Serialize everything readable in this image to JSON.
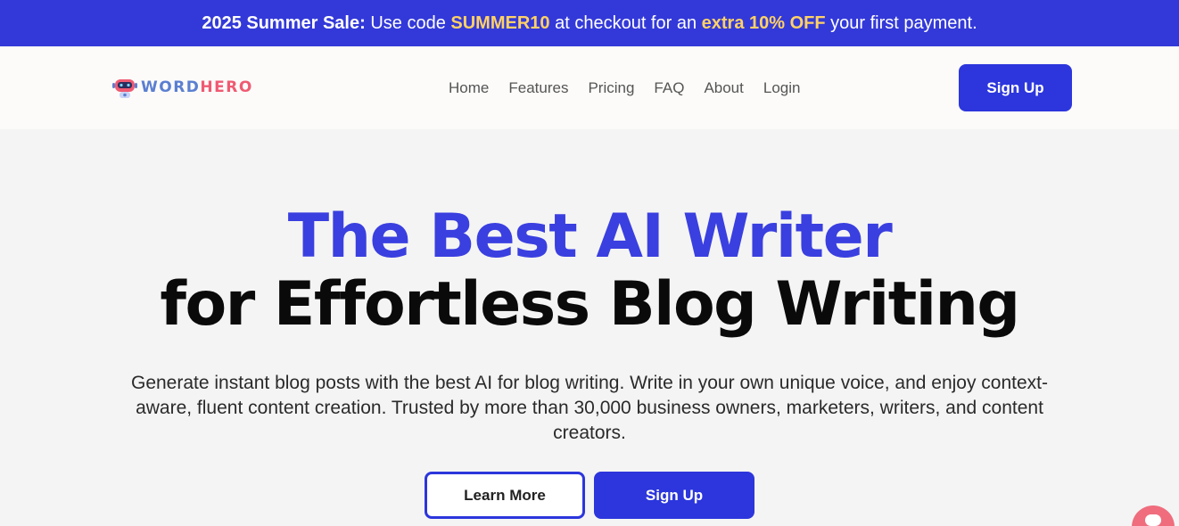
{
  "promo": {
    "label": "2025 Summer Sale:",
    "text_1": "Use code",
    "code": "SUMMER10",
    "text_2": "at checkout for an",
    "offer": "extra 10% OFF",
    "text_3": "your first payment.",
    "background": "#3339d8",
    "highlight_color": "#ffd166"
  },
  "header": {
    "logo": {
      "word": "WORD",
      "hero": "HERO",
      "icon": "robot-mascot-icon"
    },
    "nav": [
      {
        "label": "Home"
      },
      {
        "label": "Features"
      },
      {
        "label": "Pricing"
      },
      {
        "label": "FAQ"
      },
      {
        "label": "About"
      },
      {
        "label": "Login"
      }
    ],
    "signup_label": "Sign Up"
  },
  "hero": {
    "title_line_1": "The Best AI Writer",
    "title_line_2": "for Effortless Blog Writing",
    "description": "Generate instant blog posts with the best AI for blog writing. Write in your own unique voice, and enjoy context-aware, fluent content creation. Trusted by more than 30,000 business owners, marketers, writers, and content creators.",
    "learn_more_label": "Learn More",
    "signup_label": "Sign Up"
  },
  "colors": {
    "accent": "#2c36dc",
    "title_blue": "#3a3fe0",
    "chat_bubble": "#ef6d7d"
  },
  "chat": {
    "icon": "chat-bubble-icon"
  }
}
